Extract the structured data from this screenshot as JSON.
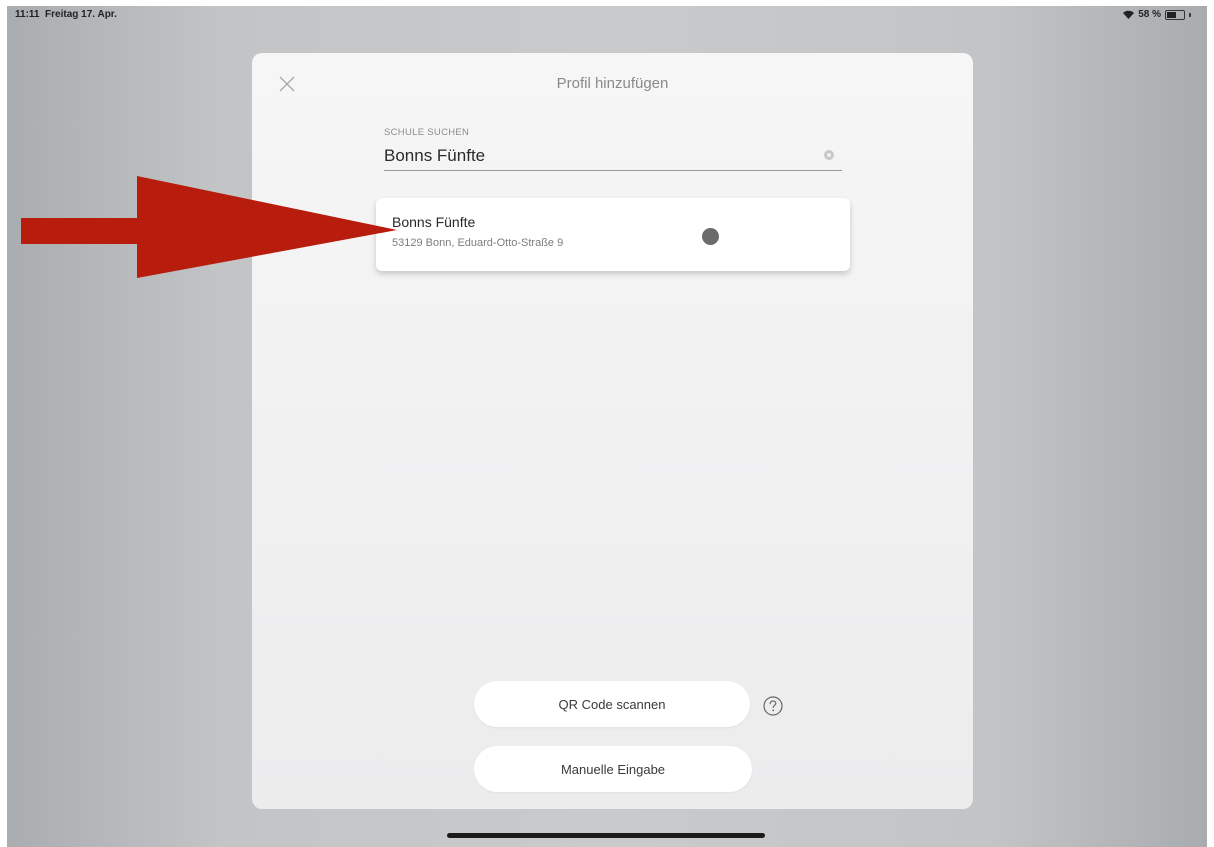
{
  "status_bar": {
    "time": "11:11",
    "date": "Freitag 17. Apr.",
    "battery_text": "58 %",
    "battery_level_percent": 58
  },
  "modal": {
    "title": "Profil hinzufügen",
    "close_icon": "close-icon"
  },
  "search": {
    "label": "SCHULE SUCHEN",
    "value": "Bonns Fünfte",
    "placeholder": ""
  },
  "results": [
    {
      "name": "Bonns Fünfte",
      "address": "53129 Bonn, Eduard-Otto-Straße 9"
    }
  ],
  "buttons": {
    "qr_label": "QR Code scannen",
    "manual_label": "Manuelle Eingabe"
  },
  "colors": {
    "arrow": "#b71c0c",
    "modal_background": "#f3f3f4",
    "backdrop": "#c4c5c7"
  }
}
